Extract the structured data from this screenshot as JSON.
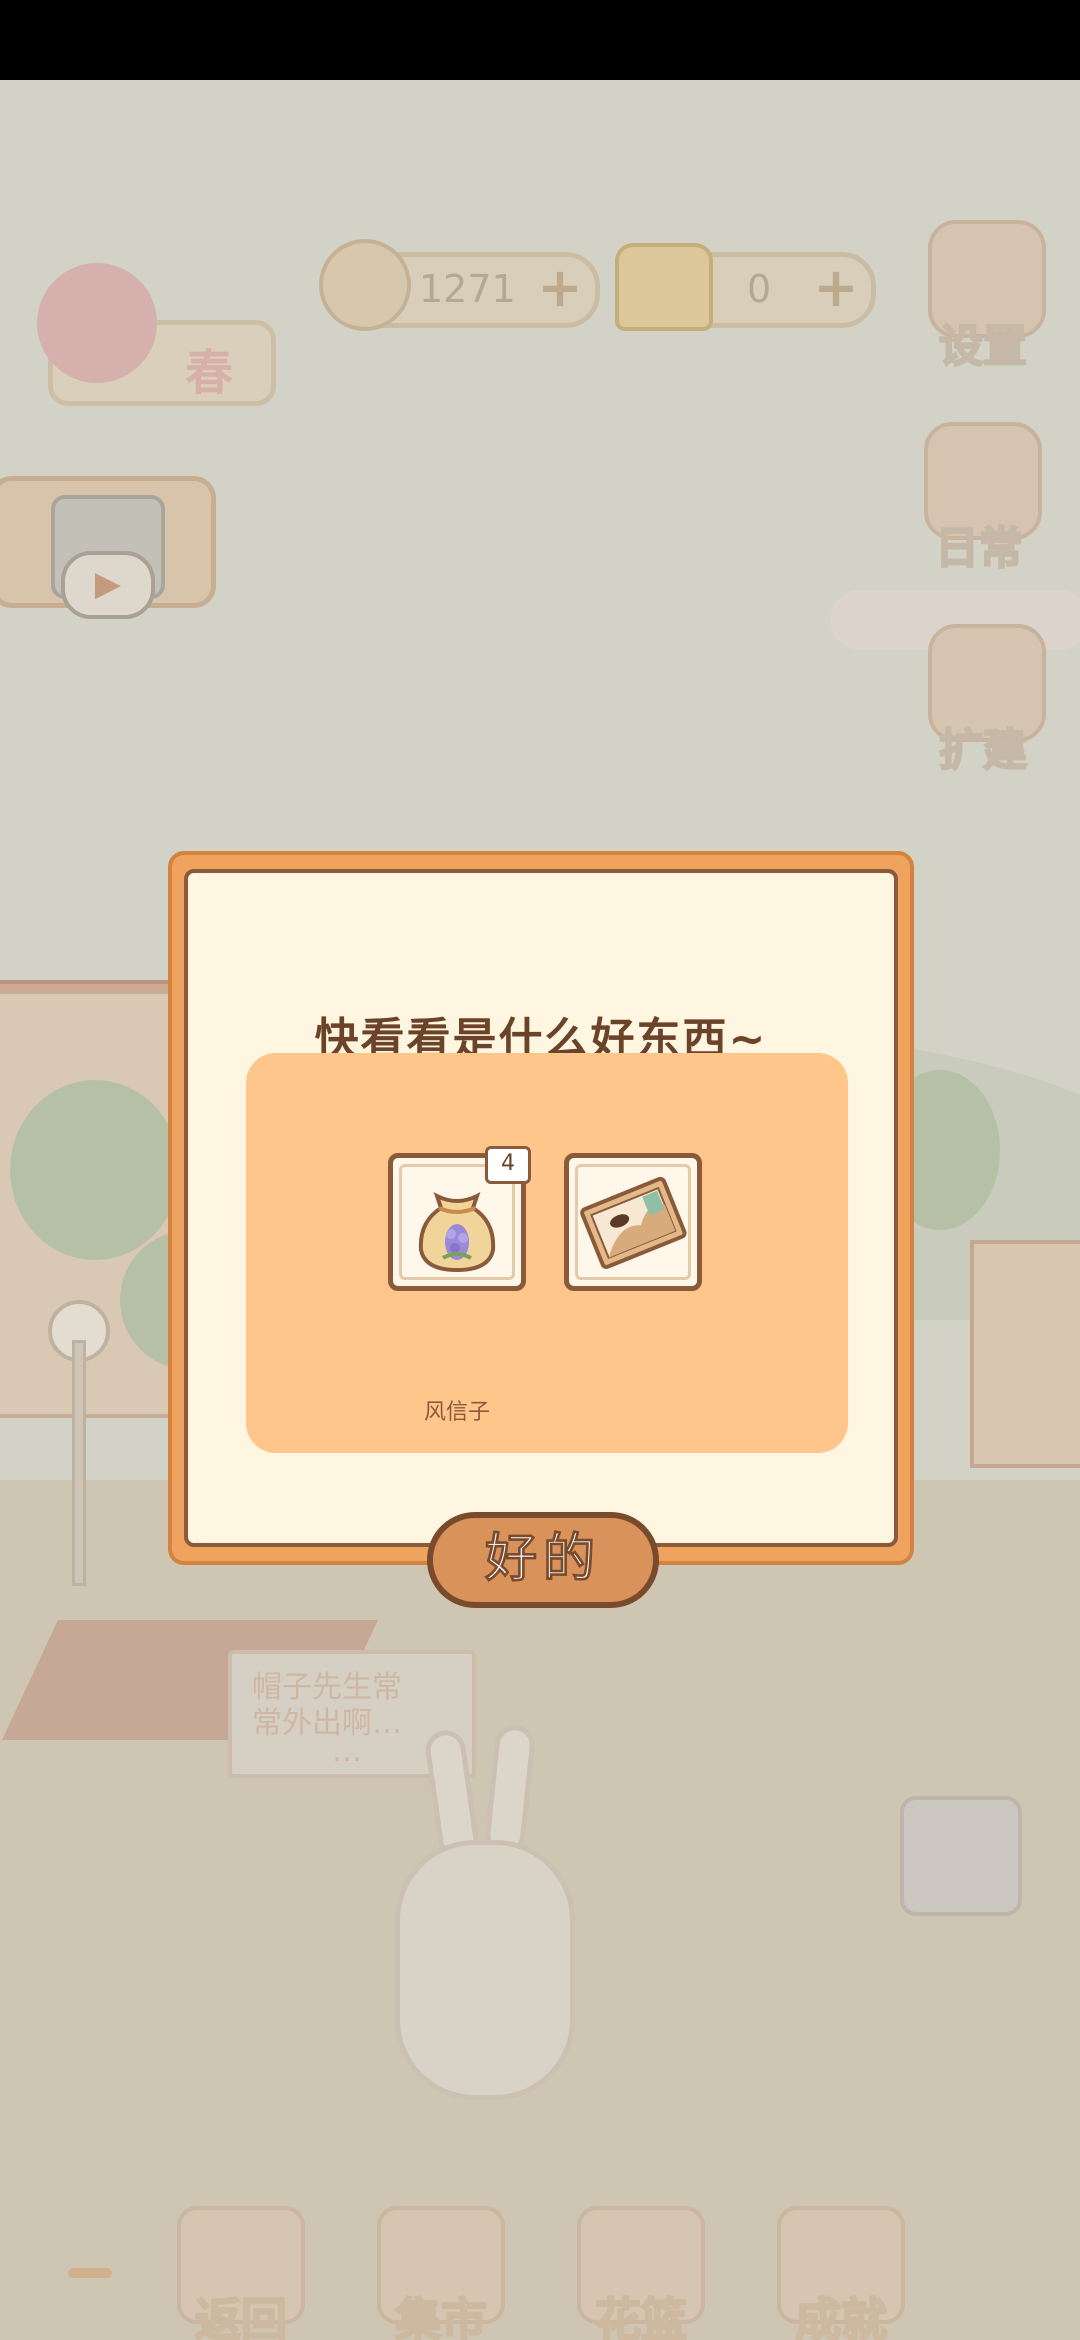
{
  "hud": {
    "season": "春",
    "fish_count": "1271",
    "cheese_count": "0",
    "plus_symbol": "+",
    "settings_label": "设置",
    "daily_label": "日常",
    "expand_label": "扩建"
  },
  "background": {
    "speech_line1": "帽子先生常",
    "speech_line2": "常外出啊…",
    "speech_line3": "…"
  },
  "bottom_nav": {
    "back_label": "返回",
    "market_label": "集市",
    "basket_label": "花篮",
    "achievement_label": "成就"
  },
  "dialog": {
    "title": "快看看是什么好东西~",
    "items": [
      {
        "icon": "seed-bag-icon",
        "label": "风信子",
        "count": "4"
      },
      {
        "icon": "picture-card-icon",
        "label": ""
      }
    ],
    "ok_label": "好的"
  },
  "colors": {
    "dialog_frame": "#f0a35e",
    "dialog_bg": "#fff6e2",
    "panel_bg": "#ffc68c",
    "text_brown": "#6b4328"
  }
}
